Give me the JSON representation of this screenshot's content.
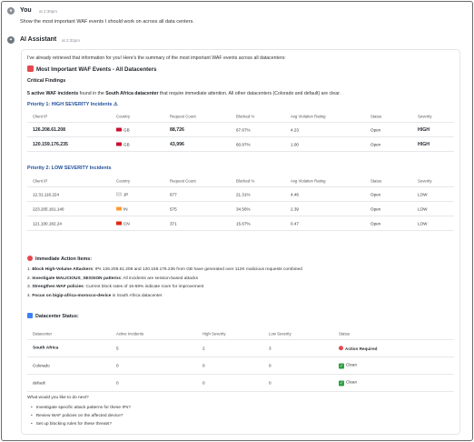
{
  "user_message": {
    "sender": "You",
    "time": "at 2:30pm",
    "text": "Show the most important WAF events I should work on across all data centers."
  },
  "ai_message": {
    "sender": "AI Assistant",
    "time": "at 2:32pm",
    "intro": "I've already retrieved that information for you! Here's the summary of the most important WAF events across all datacenters:",
    "title": "Most Important WAF Events - All Datacenters",
    "critical_heading": "Critical Findings",
    "summary_prefix": "5 active WAF incidents",
    "summary_mid": " found in the ",
    "summary_dc": "South Africa datacenter",
    "summary_suffix": " that require immediate attention. All other datacenters (Colorado and default) are clear.",
    "priority1_title": "Priority 1: HIGH SEVERITY Incidents ⚠",
    "priority2_title": "Priority 2: LOW SEVERITY Incidents",
    "incident_headers": [
      "Client IP",
      "Country",
      "Request Count",
      "Blocked %",
      "Avg Violation Rating",
      "Status",
      "Severity"
    ],
    "high_incidents": [
      {
        "ip": "126.208.61.208",
        "country": "GB",
        "requests": "88,726",
        "blocked": "67.67%",
        "rating": "4.23",
        "status": "Open",
        "severity": "HIGH"
      },
      {
        "ip": "120.159.176.235",
        "country": "GB",
        "requests": "43,996",
        "blocked": "60.97%",
        "rating": "1.00",
        "status": "Open",
        "severity": "HIGH"
      }
    ],
    "low_incidents": [
      {
        "ip": "12.31.116.224",
        "country": "JP",
        "requests": "677",
        "blocked": "21.31%",
        "rating": "4.46",
        "status": "Open",
        "severity": "LOW"
      },
      {
        "ip": "223.205.161.140",
        "country": "IN",
        "requests": "575",
        "blocked": "34.56%",
        "rating": "2.39",
        "status": "Open",
        "severity": "LOW"
      },
      {
        "ip": "121.100.182.24",
        "country": "CN",
        "requests": "371",
        "blocked": "15.67%",
        "rating": "0.47",
        "status": "Open",
        "severity": "LOW"
      }
    ],
    "actions_title": "Immediate Action Items:",
    "actions": [
      {
        "num": "1.",
        "bold": "Block High-Volume Attackers",
        "text": ": IPs 126.208.61.208 and 120.159.176.235 from GB have generated over 112K malicious requests combined"
      },
      {
        "num": "2.",
        "bold": "Investigate MALICIOUS_SESSION patterns",
        "text": ": All incidents are session-based attacks"
      },
      {
        "num": "3.",
        "bold": "Strengthen WAF policies",
        "text": ": Current block rates of 15-68% indicate room for improvement"
      },
      {
        "num": "4.",
        "bold": "Focus on bigip-africa-morocco-device",
        "text": " in South Africa datacenter"
      }
    ],
    "dc_title": "Datacenter Status:",
    "dc_headers": [
      "Datacenter",
      "Active Incidents",
      "High Severity",
      "Low Severity",
      "Status"
    ],
    "dc_rows": [
      {
        "name": "South Africa",
        "active": "5",
        "high": "2",
        "low": "3",
        "status": "Action Required",
        "kind": "alert"
      },
      {
        "name": "Colorado",
        "active": "0",
        "high": "0",
        "low": "0",
        "status": "Clean",
        "kind": "ok"
      },
      {
        "name": "default",
        "active": "0",
        "high": "0",
        "low": "0",
        "status": "Clean",
        "kind": "ok"
      }
    ],
    "ask": "What would you like to do next?",
    "suggestions": [
      "Investigate specific attack patterns for these IPs?",
      "Review WAF policies on the affected device?",
      "Set up blocking rules for these threats?"
    ]
  },
  "colors": {
    "priority_title": "#1f4e9c",
    "alert_red": "#e5484d",
    "ok_green": "#2ea043",
    "flag_gb": "#c8102e",
    "flag_jp": "#e8e8e8",
    "flag_in": "#ff9933",
    "flag_cn": "#de2910"
  }
}
